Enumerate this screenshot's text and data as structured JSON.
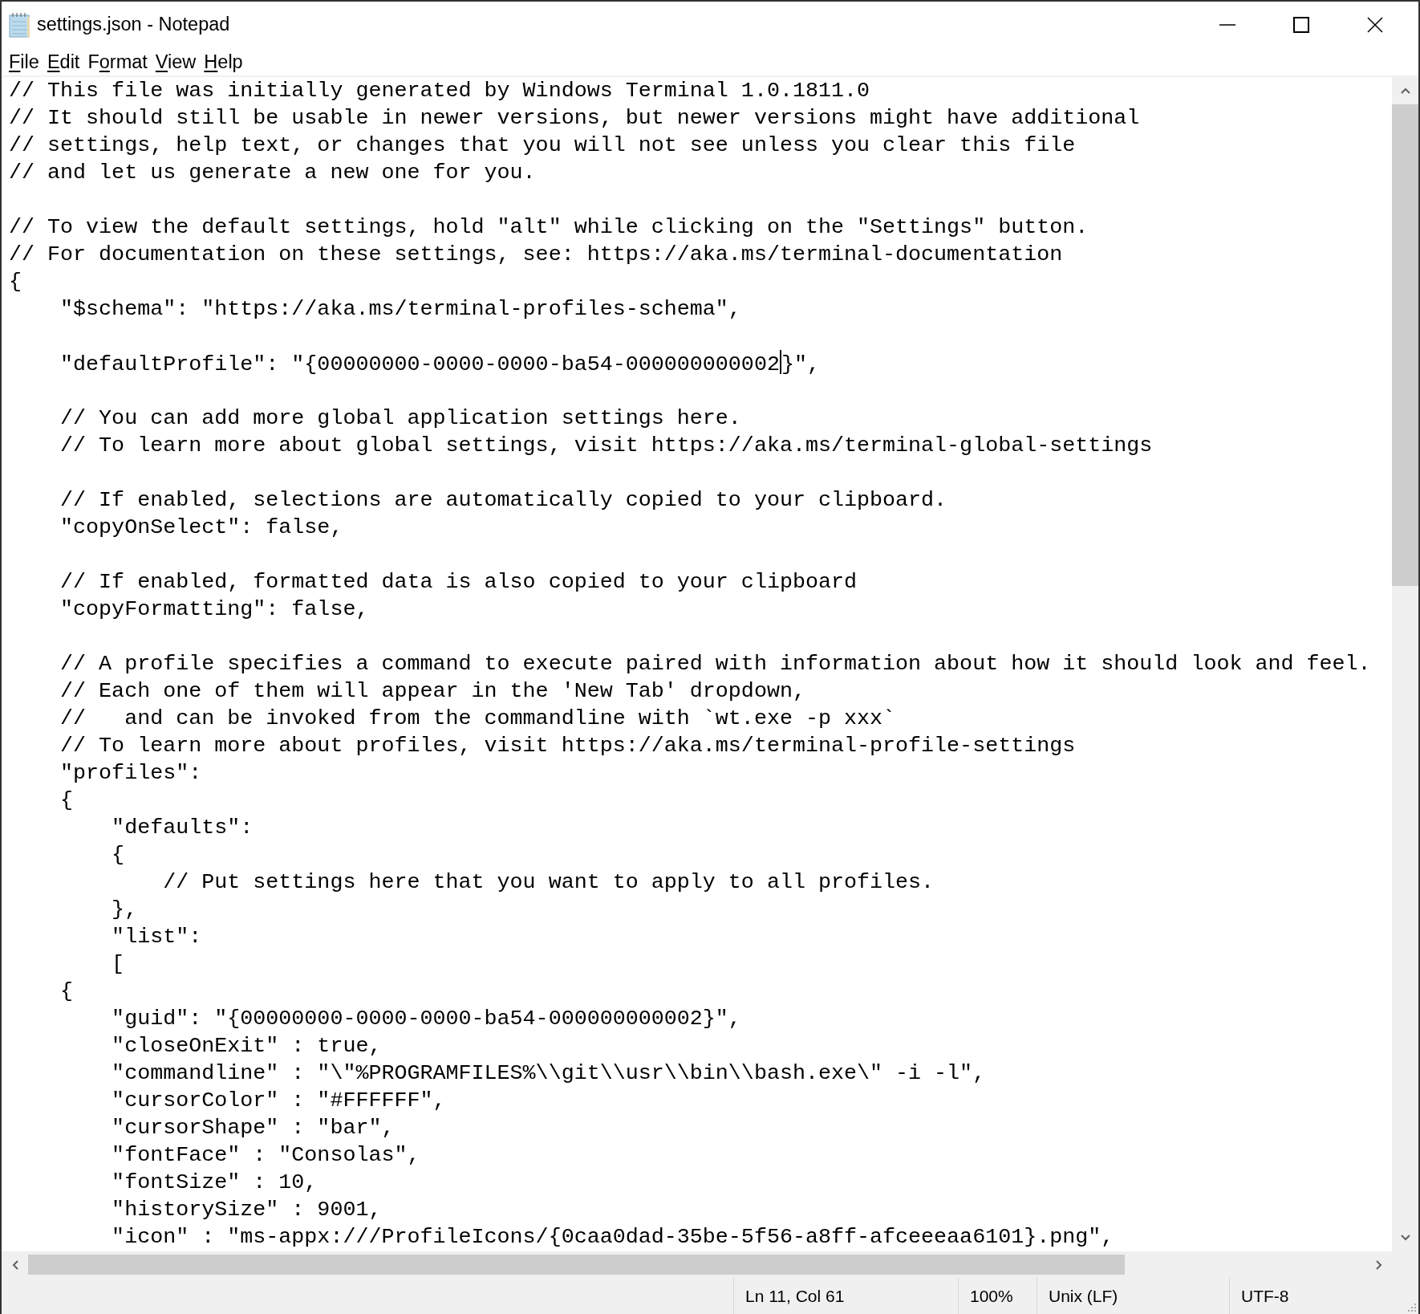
{
  "window": {
    "title": "settings.json - Notepad"
  },
  "menu": [
    {
      "key": "F",
      "rest": "ile"
    },
    {
      "key": "E",
      "rest": "dit"
    },
    {
      "lead": "F",
      "key": "o",
      "rest": "rmat"
    },
    {
      "key": "V",
      "rest": "iew"
    },
    {
      "key": "H",
      "rest": "elp"
    }
  ],
  "editor": {
    "blocks": [
      {
        "lines": [
          {
            "text": "// This file was initially generated by Windows Terminal 1.0.1811.0"
          },
          {
            "text": "// It should still be usable in newer versions, but newer versions might have additional"
          },
          {
            "text": "// settings, help text, or changes that you will not see unless you clear this file"
          },
          {
            "text": "// and let us generate a new one for you."
          }
        ]
      },
      {
        "lines": [
          {
            "text": "// To view the default settings, hold \"alt\" while clicking on the \"Settings\" button."
          },
          {
            "text": "// For documentation on these settings, see: https://aka.ms/terminal-documentation"
          },
          {
            "text": "{"
          },
          {
            "text": "    \"$schema\": \"https://aka.ms/terminal-profiles-schema\","
          }
        ]
      },
      {
        "lines": [
          {
            "text": "    \"defaultProfile\": \"{00000000-0000-0000-ba54-000000000002",
            "caret": true,
            "after_caret": "}\","
          }
        ]
      },
      {
        "lines": [
          {
            "text": "    // You can add more global application settings here."
          },
          {
            "text": "    // To learn more about global settings, visit https://aka.ms/terminal-global-settings"
          }
        ]
      },
      {
        "lines": [
          {
            "text": "    // If enabled, selections are automatically copied to your clipboard."
          },
          {
            "text": "    \"copyOnSelect\": false,"
          }
        ]
      },
      {
        "lines": [
          {
            "text": "    // If enabled, formatted data is also copied to your clipboard"
          },
          {
            "text": "    \"copyFormatting\": false,"
          }
        ]
      },
      {
        "lines": [
          {
            "text": "    // A profile specifies a command to execute paired with information about how it should look and feel."
          },
          {
            "text": "    // Each one of them will appear in the 'New Tab' dropdown,"
          },
          {
            "text": "    //   and can be invoked from the commandline with `wt.exe -p xxx`"
          },
          {
            "text": "    // To learn more about profiles, visit https://aka.ms/terminal-profile-settings"
          },
          {
            "text": "    \"profiles\":"
          },
          {
            "text": "    {"
          },
          {
            "text": "        \"defaults\":"
          },
          {
            "text": "        {"
          },
          {
            "text": "            // Put settings here that you want to apply to all profiles."
          },
          {
            "text": "        },"
          },
          {
            "text": "        \"list\":"
          },
          {
            "text": "        ["
          },
          {
            "text": "    {"
          },
          {
            "text": "        \"guid\": \"{00000000-0000-0000-ba54-000000000002}\","
          },
          {
            "text": "        \"closeOnExit\" : true,"
          },
          {
            "text": "        \"commandline\" : \"\\\"%PROGRAMFILES%\\\\git\\\\usr\\\\bin\\\\bash.exe\\\" -i -l\","
          },
          {
            "text": "        \"cursorColor\" : \"#FFFFFF\","
          },
          {
            "text": "        \"cursorShape\" : \"bar\","
          },
          {
            "text": "        \"fontFace\" : \"Consolas\","
          },
          {
            "text": "        \"fontSize\" : 10,"
          },
          {
            "text": "        \"historySize\" : 9001,"
          },
          {
            "text": "        \"icon\" : \"ms-appx:///ProfileIcons/{0caa0dad-35be-5f56-a8ff-afceeeaa6101}.png\","
          }
        ]
      }
    ]
  },
  "status_bar": {
    "position": "Ln 11, Col 61",
    "zoom": "100%",
    "line_endings": "Unix (LF)",
    "encoding": "UTF-8"
  }
}
